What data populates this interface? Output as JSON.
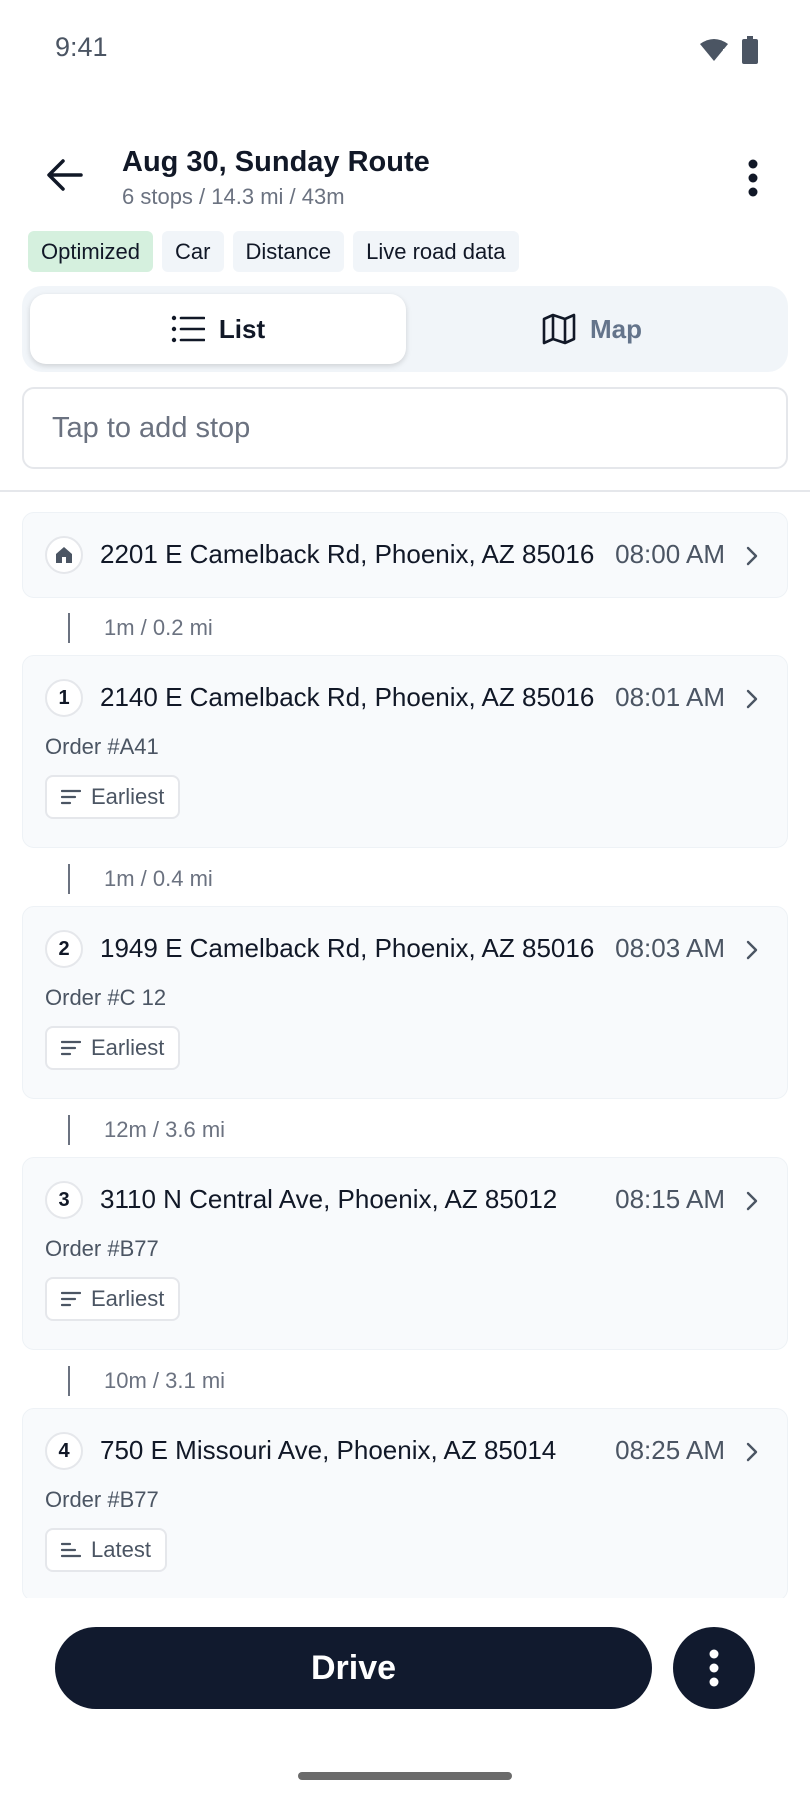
{
  "status": {
    "time": "9:41"
  },
  "header": {
    "title": "Aug 30, Sunday Route",
    "subtitle": "6 stops / 14.3 mi / 43m"
  },
  "chips": [
    "Optimized",
    "Car",
    "Distance",
    "Live road data"
  ],
  "view_toggle": {
    "list_label": "List",
    "map_label": "Map",
    "selected": "List"
  },
  "add_stop": {
    "placeholder": "Tap to add stop"
  },
  "stops": [
    {
      "marker": "home",
      "address": "2201 E Camelback Rd, Phoenix, AZ 85016",
      "time": "08:00 AM"
    },
    {
      "marker": "1",
      "address": "2140 E Camelback Rd, Phoenix, AZ 85016",
      "time": "08:01 AM",
      "order": "Order #A41",
      "tag": "Earliest"
    },
    {
      "marker": "2",
      "address": "1949 E Camelback Rd, Phoenix, AZ 85016",
      "time": "08:03 AM",
      "order": "Order #C 12",
      "tag": "Earliest"
    },
    {
      "marker": "3",
      "address": "3110 N Central Ave, Phoenix, AZ 85012",
      "time": "08:15 AM",
      "order": "Order #B77",
      "tag": "Earliest"
    },
    {
      "marker": "4",
      "address": "750 E Missouri Ave, Phoenix, AZ 85014",
      "time": "08:25 AM",
      "order": "Order #B77",
      "tag": "Latest"
    }
  ],
  "legs": [
    "1m / 0.2 mi",
    "1m / 0.4 mi",
    "12m / 3.6 mi",
    "10m / 3.1 mi"
  ],
  "bottom": {
    "drive_label": "Drive"
  },
  "icons": {
    "wifi": "wifi-alert-icon",
    "battery": "battery-icon",
    "back": "arrow-left-icon",
    "more": "more-vertical-icon",
    "list": "list-icon",
    "map": "map-icon",
    "home": "home-icon",
    "chevron": "chevron-right-icon",
    "sort_earliest": "sort-lines-icon",
    "sort_latest": "sort-lines-left-icon"
  },
  "colors": {
    "primary": "#111a2e",
    "optimized_chip": "#d5f0de",
    "card": "#f8fafc"
  }
}
